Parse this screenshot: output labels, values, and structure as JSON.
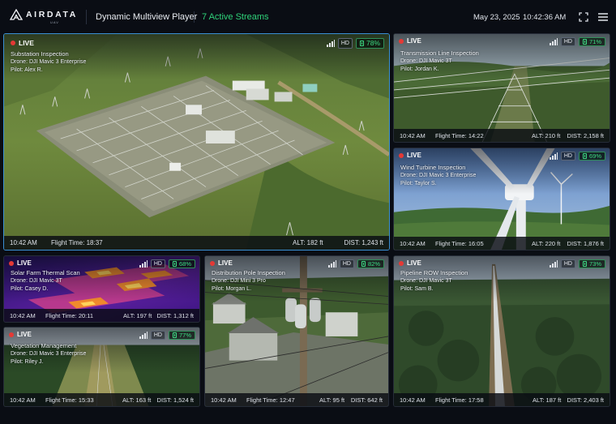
{
  "header": {
    "logo_text": "AIRDATA",
    "logo_sub": "UAV",
    "title": "Dynamic Multiview Player",
    "streams": "7 Active Streams",
    "date": "May 23, 2025",
    "time": "10:42:36 AM",
    "expand_icon": "fullscreen-icon",
    "menu_icon": "hamburger-menu-icon"
  },
  "colors": {
    "background": "#0a0d14",
    "accent_green": "#2fd37a",
    "live_red": "#e53935",
    "active_border": "#3a8fd4"
  },
  "streams": [
    {
      "live": "LIVE",
      "title": "Substation Inspection",
      "drone": "Drone: DJI Mavic 3 Enterprise",
      "pilot": "Pilot: Alex R.",
      "hd": "HD",
      "battery": "78%",
      "time": "10:42 AM",
      "flight_time": "Flight Time: 18:37",
      "alt": "ALT: 182 ft",
      "dist": "DIST: 1,243 ft"
    },
    {
      "live": "LIVE",
      "title": "Transmission Line Inspection",
      "drone": "Drone: DJI Mavic 3T",
      "pilot": "Pilot: Jordan K.",
      "hd": "HD",
      "battery": "71%",
      "time": "10:42 AM",
      "flight_time": "Flight Time: 14:22",
      "alt": "ALT: 210 ft",
      "dist": "DIST: 2,158 ft"
    },
    {
      "live": "LIVE",
      "title": "Wind Turbine Inspection",
      "drone": "Drone: DJI Mavic 3 Enterprise",
      "pilot": "Pilot: Taylor S.",
      "hd": "HD",
      "battery": "69%",
      "time": "10:42 AM",
      "flight_time": "Flight Time: 16:05",
      "alt": "ALT: 220 ft",
      "dist": "DIST: 1,876 ft"
    },
    {
      "live": "LIVE",
      "title": "Solar Farm Thermal Scan",
      "drone": "Drone: DJI Mavic 3T",
      "pilot": "Pilot: Casey D.",
      "hd": "HD",
      "battery": "68%",
      "time": "10:42 AM",
      "flight_time": "Flight Time: 20:11",
      "alt": "ALT: 197 ft",
      "dist": "DIST: 1,312 ft"
    },
    {
      "live": "LIVE",
      "title": "Distribution Pole Inspection",
      "drone": "Drone: DJI Mini 3 Pro",
      "pilot": "Pilot: Morgan L.",
      "hd": "HD",
      "battery": "82%",
      "time": "10:42 AM",
      "flight_time": "Flight Time: 12:47",
      "alt": "ALT: 95 ft",
      "dist": "DIST: 642 ft"
    },
    {
      "live": "LIVE",
      "title": "Pipeline ROW Inspection",
      "drone": "Drone: DJI Mavic 3T",
      "pilot": "Pilot: Sam B.",
      "hd": "HD",
      "battery": "73%",
      "time": "10:42 AM",
      "flight_time": "Flight Time: 17:58",
      "alt": "ALT: 187 ft",
      "dist": "DIST: 2,403 ft"
    },
    {
      "live": "LIVE",
      "title": "Vegetation Management",
      "drone": "Drone: DJI Mavic 3 Enterprise",
      "pilot": "Pilot: Riley J.",
      "hd": "HD",
      "battery": "77%",
      "time": "10:42 AM",
      "flight_time": "Flight Time: 15:33",
      "alt": "ALT: 163 ft",
      "dist": "DIST: 1,524 ft"
    }
  ]
}
